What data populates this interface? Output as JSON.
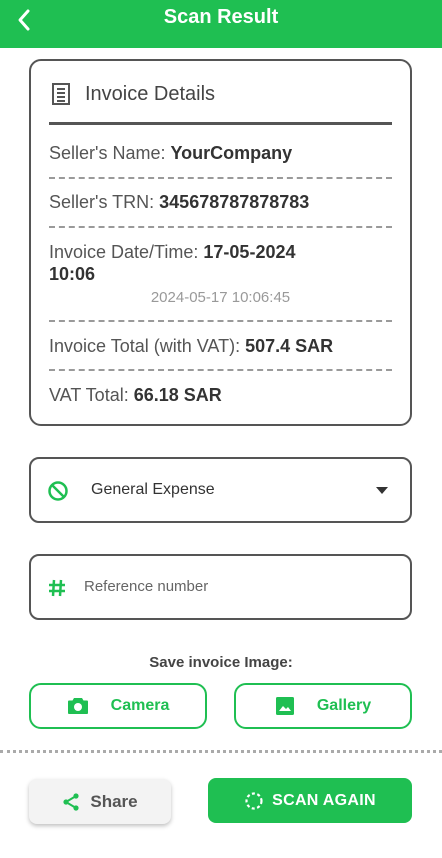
{
  "header": {
    "title": "Scan Result"
  },
  "invoice": {
    "heading": "Invoice Details",
    "seller_name_label": "Seller's Name:",
    "seller_name_value": "YourCompany",
    "seller_trn_label": "Seller's TRN:",
    "seller_trn_value": "345678787878783",
    "date_label": "Invoice Date/Time:",
    "date_value_line1": "17-05-2024",
    "date_value_line2": "10:06",
    "date_raw": "2024-05-17 10:06:45",
    "total_label": "Invoice Total (with VAT):",
    "total_value": "507.4 SAR",
    "vat_label": "VAT Total:",
    "vat_value": "66.18 SAR"
  },
  "category": {
    "selected": "General Expense"
  },
  "reference": {
    "placeholder": "Reference number"
  },
  "save_image": {
    "label": "Save invoice Image:",
    "camera_label": "Camera",
    "gallery_label": "Gallery"
  },
  "actions": {
    "share_label": "Share",
    "scan_again_label": "SCAN AGAIN"
  },
  "colors": {
    "accent": "#1fbf52"
  },
  "icons": {
    "back": "arrow-back-icon",
    "receipt": "receipt-icon",
    "category": "block-icon",
    "dropdown": "caret-down-icon",
    "reference": "hash-icon",
    "camera": "camera-icon",
    "gallery": "image-icon",
    "share": "share-icon",
    "scan": "refresh-icon"
  }
}
